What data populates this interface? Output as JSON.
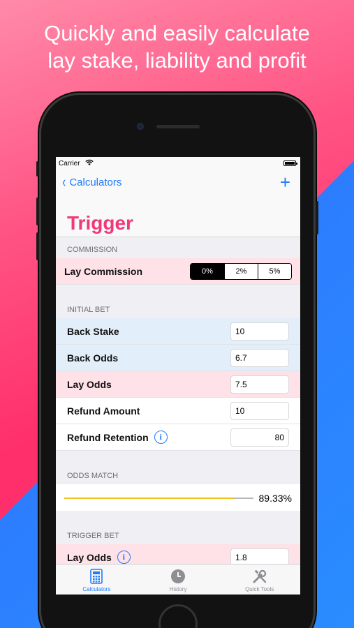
{
  "headline": {
    "line1": "Quickly and easily calculate",
    "line2": "lay stake, liability and profit"
  },
  "status_bar": {
    "carrier": "Carrier"
  },
  "nav": {
    "back_label": "Calculators",
    "title": "Trigger"
  },
  "commission": {
    "header": "COMMISSION",
    "label": "Lay Commission",
    "options": [
      "0%",
      "2%",
      "5%"
    ],
    "selected": "0%"
  },
  "initial_bet": {
    "header": "INITIAL BET",
    "rows": [
      {
        "label": "Back Stake",
        "value": "10"
      },
      {
        "label": "Back Odds",
        "value": "6.7"
      },
      {
        "label": "Lay Odds",
        "value": "7.5"
      },
      {
        "label": "Refund Amount",
        "value": "10"
      },
      {
        "label": "Refund Retention",
        "value": "80"
      }
    ]
  },
  "odds_match": {
    "header": "ODDS MATCH",
    "value": "89.33%",
    "fraction": 0.8933
  },
  "trigger_bet": {
    "header": "TRIGGER BET",
    "rows": [
      {
        "label": "Lay Odds",
        "value": "1.8"
      }
    ]
  },
  "tabbar": {
    "tabs": [
      {
        "label": "Calculators",
        "icon": "calculator-icon",
        "active": true
      },
      {
        "label": "History",
        "icon": "clock-icon",
        "active": false
      },
      {
        "label": "Quick Tools",
        "icon": "tools-icon",
        "active": false
      }
    ]
  },
  "colors": {
    "accent": "#1f7aff",
    "title_pink": "#f0397a",
    "row_pink": "#ffe1e8",
    "row_blue": "#e2eefa",
    "slider_fill": "#f2c318"
  }
}
